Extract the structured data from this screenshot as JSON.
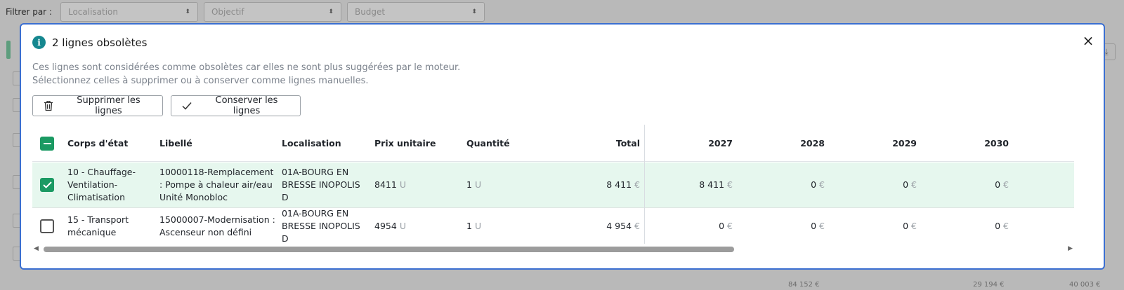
{
  "background": {
    "filter_label": "Filtrer par",
    "filters": [
      "Localisation",
      "Objectif",
      "Budget"
    ],
    "bottom_numbers": [
      "84 152 €",
      "29 194 €",
      "40 003 €"
    ]
  },
  "modal": {
    "title": "2 lignes obsolètes",
    "description_line1": "Ces lignes sont considérées comme obsolètes car elles ne sont plus suggérées par le moteur.",
    "description_line2": "Sélectionnez celles à supprimer ou à conserver comme lignes manuelles.",
    "delete_label": "Supprimer les lignes",
    "keep_label": "Conserver les lignes",
    "close_label": "×",
    "icons": {
      "info": "i",
      "delete": "trash-icon",
      "keep": "check-icon",
      "close": "close-icon"
    },
    "colors": {
      "accent": "#1b9a63",
      "selected_row": "#e6f7ee",
      "border": "#3b6fd1",
      "info": "#15878f"
    }
  },
  "table": {
    "headers": {
      "corps": "Corps d'état",
      "libelle": "Libellé",
      "localisation": "Localisation",
      "prix": "Prix unitaire",
      "quantite": "Quantité",
      "total": "Total",
      "y2027": "2027",
      "y2028": "2028",
      "y2029": "2029",
      "y2030": "2030"
    },
    "rows": [
      {
        "checked": true,
        "corps": "10 - Chauffage-Ventilation-Climatisation",
        "libelle": "10000118-Remplacement : Pompe à chaleur air/eau Unité Monobloc",
        "localisation": "01A-BOURG EN BRESSE INOPOLIS D",
        "prix": "8411",
        "prix_unit": "U",
        "quantite": "1",
        "quantite_unit": "U",
        "total": "8 411",
        "y2027": "8 411",
        "y2028": "0",
        "y2029": "0",
        "y2030": "0",
        "currency": "€"
      },
      {
        "checked": false,
        "corps": "15 - Transport mécanique",
        "libelle": "15000007-Modernisation : Ascenseur non défini",
        "localisation": "01A-BOURG EN BRESSE INOPOLIS D",
        "prix": "4954",
        "prix_unit": "U",
        "quantite": "1",
        "quantite_unit": "U",
        "total": "4 954",
        "y2027": "0",
        "y2028": "0",
        "y2029": "0",
        "y2030": "0",
        "currency": "€"
      }
    ]
  },
  "scrollbar": {
    "thumb_fraction": 0.66
  }
}
